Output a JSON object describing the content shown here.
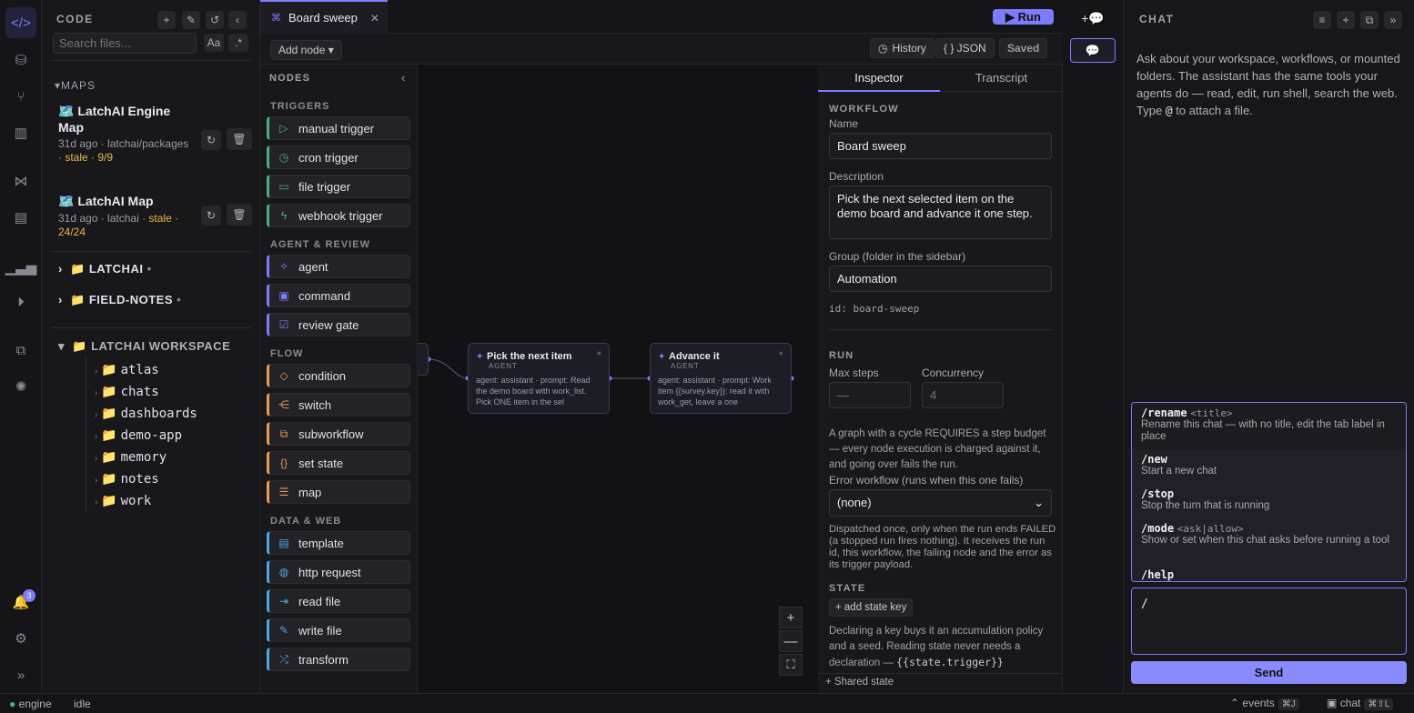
{
  "colors": {
    "accent": "#7c7cff",
    "stale": "#e8b64a",
    "trigger": "#4caf83",
    "agent": "#7c7cff",
    "flow": "#e8a050",
    "data": "#4aa8e8"
  },
  "sidebar": {
    "title": "CODE",
    "search_placeholder": "Search files...",
    "case_toggle": "Aa",
    "regex_toggle": ".*",
    "maps_header": "MAPS",
    "maps": [
      {
        "title": "🗺️ LatchAI Engine Map",
        "meta": "31d ago · latchai/packages · ",
        "stale": "stale · 9/9"
      },
      {
        "title": "🗺️ LatchAI Map",
        "meta": "31d ago · latchai · ",
        "stale": "stale · 24/24"
      }
    ],
    "roots": [
      {
        "label": "LATCHAI"
      },
      {
        "label": "FIELD-NOTES"
      }
    ],
    "workspace": {
      "label": "LATCHAI WORKSPACE",
      "folders": [
        "atlas",
        "chats",
        "dashboards",
        "demo-app",
        "memory",
        "notes",
        "work"
      ]
    },
    "notifications_count": "3"
  },
  "editor": {
    "tab_label": "Board sweep",
    "run_label": "▶ Run",
    "add_node": "Add node ▾",
    "history": "History",
    "json": "{ } JSON",
    "saved": "Saved"
  },
  "palette": {
    "title": "NODES",
    "categories": [
      {
        "label": "TRIGGERS",
        "items": [
          "manual trigger",
          "cron trigger",
          "file trigger",
          "webhook trigger"
        ]
      },
      {
        "label": "AGENT & REVIEW",
        "items": [
          "agent",
          "command",
          "review gate"
        ]
      },
      {
        "label": "FLOW",
        "items": [
          "condition",
          "switch",
          "subworkflow",
          "set state",
          "map"
        ]
      },
      {
        "label": "DATA & WEB",
        "items": [
          "template",
          "http request",
          "read file",
          "write file",
          "transform"
        ]
      }
    ]
  },
  "canvas": {
    "nodes": [
      {
        "title": "Pick the next item",
        "kind": "AGENT",
        "body": "agent: assistant · prompt: Read the demo board with work_list. Pick ONE item in the sel"
      },
      {
        "title": "Advance it",
        "kind": "AGENT",
        "body": "agent: assistant · prompt: Work item {{survey.key}}: read it with work_get, leave a one"
      }
    ],
    "zoom_in": "+",
    "zoom_out": "—",
    "fit": "⛶"
  },
  "inspector": {
    "tab_inspector": "Inspector",
    "tab_transcript": "Transcript",
    "section_workflow": "WORKFLOW",
    "name_label": "Name",
    "name_value": "Board sweep",
    "desc_label": "Description",
    "desc_value": "Pick the next selected item on the demo board and advance it one step.",
    "group_label": "Group (folder in the sidebar)",
    "group_value": "Automation",
    "id_text": "id: board-sweep",
    "section_run": "RUN",
    "max_steps_label": "Max steps",
    "max_steps_placeholder": "—",
    "concurrency_label": "Concurrency",
    "concurrency_placeholder": "4",
    "cycle_help": "A graph with a cycle REQUIRES a step budget — every node execution is charged against it, and going over fails the run.",
    "error_wf_label": "Error workflow (runs when this one fails)",
    "error_wf_value": "(none)",
    "error_help": "Dispatched once, only when the run ends FAILED (a stopped run fires nothing). It receives the run id, this workflow, the failing node and the error as its trigger payload.",
    "section_state": "STATE",
    "add_state_key": "+ add state key",
    "state_help": "Declaring a key buys it an accumulation policy and a seed. Reading state never needs a declaration — ",
    "state_code": "{{state.trigger}}",
    "shared_state": "+ Shared state"
  },
  "chat": {
    "title": "CHAT",
    "intro_a": "Ask about your workspace, workflows, or mounted folders. The assistant has the same tools your agents do — read, edit, run shell, search the web. Type ",
    "intro_at": "@",
    "intro_b": " to attach a file.",
    "commands": [
      {
        "name": "/rename",
        "args": "<title>",
        "desc": "Rename this chat — with no title, edit the tab label in place"
      },
      {
        "name": "/new",
        "args": "",
        "desc": "Start a new chat"
      },
      {
        "name": "/stop",
        "args": "",
        "desc": "Stop the turn that is running"
      },
      {
        "name": "/mode",
        "args": "<ask|allow>",
        "desc": "Show or set when this chat asks before running a tool"
      },
      {
        "name": "/help",
        "args": "",
        "desc": ""
      }
    ],
    "input_value": "/",
    "send_label": "Send"
  },
  "status": {
    "engine": "engine",
    "state": "idle",
    "events": "events",
    "events_kbd": "⌘J",
    "chat": "chat",
    "chat_kbd": "⌘⇧L"
  }
}
